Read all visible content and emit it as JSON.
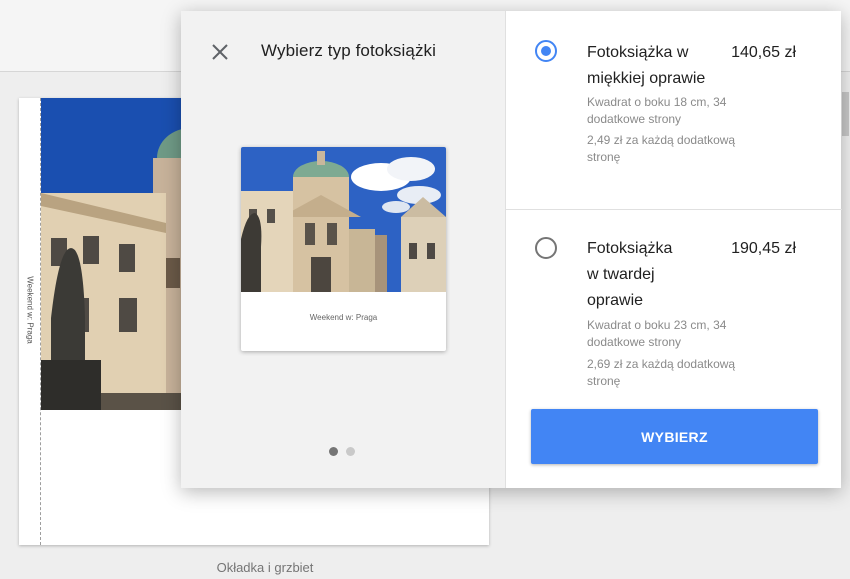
{
  "background": {
    "spine_text": "Weekend w: Praga",
    "caption": "Okładka i grzbiet"
  },
  "dialog": {
    "title": "Wybierz typ fotoksiążki",
    "close_icon": "close-icon",
    "preview": {
      "book_label": "Weekend w: Praga",
      "carousel_pages": 2,
      "carousel_active": 1
    },
    "options": [
      {
        "name": "Fotoksiążka w miękkiej oprawie",
        "price": "140,65 zł",
        "size": "Kwadrat o boku 18 cm, 34 dodatkowe strony",
        "extra": "2,49 zł za każdą dodatkową stronę",
        "selected": true
      },
      {
        "name": "Fotoksiążka w twardej oprawie",
        "price": "190,45 zł",
        "size": "Kwadrat o boku 23 cm, 34 dodatkowe strony",
        "extra": "2,69 zł za każdą dodatkową stronę",
        "selected": false
      }
    ],
    "select_button": "WYBIERZ"
  },
  "colors": {
    "accent": "#4285f4",
    "text_primary": "#212121",
    "text_secondary": "#8a8a8a"
  }
}
